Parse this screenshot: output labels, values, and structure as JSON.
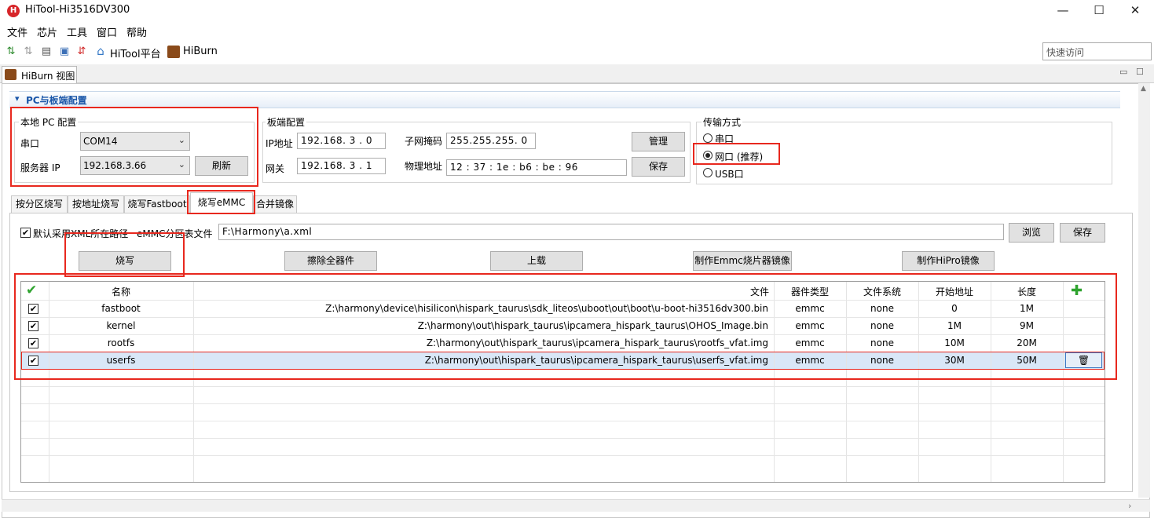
{
  "window": {
    "title": "HiTool-Hi3516DV300",
    "logo_text": "H",
    "minimize": "—",
    "maximize": "☐",
    "close": "✕"
  },
  "menu": [
    "文件",
    "芯片",
    "工具",
    "窗口",
    "帮助"
  ],
  "toolbar": {
    "hitool_label": "HiTool平台",
    "hiburn_label": "HiBurn",
    "quick_access_placeholder": "快速访问"
  },
  "view_tab": {
    "label": "HiBurn 视图",
    "minimize": "▭",
    "maximize": "☐"
  },
  "section": {
    "title": "PC与板端配置",
    "arrow": "▾"
  },
  "local_pc": {
    "group": "本地 PC 配置",
    "serial_label": "串口",
    "serial_value": "COM14",
    "server_ip_label": "服务器 IP",
    "server_ip_value": "192.168.3.66",
    "refresh_label": "刷新"
  },
  "board": {
    "group": "板端配置",
    "ip_label": "IP地址",
    "ip_value": "192.168. 3 . 0",
    "gateway_label": "网关",
    "gateway_value": "192.168. 3 . 1",
    "mask_label": "子网掩码",
    "mask_value": "255.255.255. 0",
    "mac_label": "物理地址",
    "mac_value": "12 : 37 : 1e : b6 : be : 96",
    "manage_label": "管理",
    "save_label": "保存"
  },
  "transfer": {
    "group": "传输方式",
    "options": [
      "串口",
      "网口 (推荐)",
      "USB口"
    ],
    "selected": "网口 (推荐)"
  },
  "tabs": [
    "按分区烧写",
    "按地址烧写",
    "烧写Fastboot",
    "烧写eMMC",
    "合并镜像"
  ],
  "active_tab": "烧写eMMC",
  "emmc": {
    "default_xml_label": "默认采用XML所在路径",
    "partition_label": "eMMC分区表文件",
    "partition_path": "F:\\Harmony\\a.xml",
    "browse_label": "浏览",
    "save_label": "保存",
    "burn_label": "烧写",
    "erase_label": "擦除全器件",
    "upload_label": "上载",
    "make_emmc_label": "制作Emmc烧片器镜像",
    "make_hipro_label": "制作HiPro镜像"
  },
  "table": {
    "headers": [
      "名称",
      "文件",
      "器件类型",
      "文件系统",
      "开始地址",
      "长度"
    ],
    "header_check_icon": "✔",
    "add_icon": "✚",
    "rows": [
      {
        "checked": "✔",
        "name": "fastboot",
        "file": "Z:\\harmony\\device\\hisilicon\\hispark_taurus\\sdk_liteos\\uboot\\out\\boot\\u-boot-hi3516dv300.bin",
        "type": "emmc",
        "fs": "none",
        "start": "0",
        "length": "1M"
      },
      {
        "checked": "✔",
        "name": "kernel",
        "file": "Z:\\harmony\\out\\hispark_taurus\\ipcamera_hispark_taurus\\OHOS_Image.bin",
        "type": "emmc",
        "fs": "none",
        "start": "1M",
        "length": "9M"
      },
      {
        "checked": "✔",
        "name": "rootfs",
        "file": "Z:\\harmony\\out\\hispark_taurus\\ipcamera_hispark_taurus\\rootfs_vfat.img",
        "type": "emmc",
        "fs": "none",
        "start": "10M",
        "length": "20M"
      },
      {
        "checked": "✔",
        "name": "userfs",
        "file": "Z:\\harmony\\out\\hispark_taurus\\ipcamera_hispark_taurus\\userfs_vfat.img",
        "type": "emmc",
        "fs": "none",
        "start": "30M",
        "length": "50M"
      }
    ],
    "delete_icon": "🗑"
  },
  "colors": {
    "highlight": "#e8281e",
    "selected_row": "#d9e7f7",
    "section_title": "#1a56a8",
    "add_green": "#2ea32e"
  }
}
